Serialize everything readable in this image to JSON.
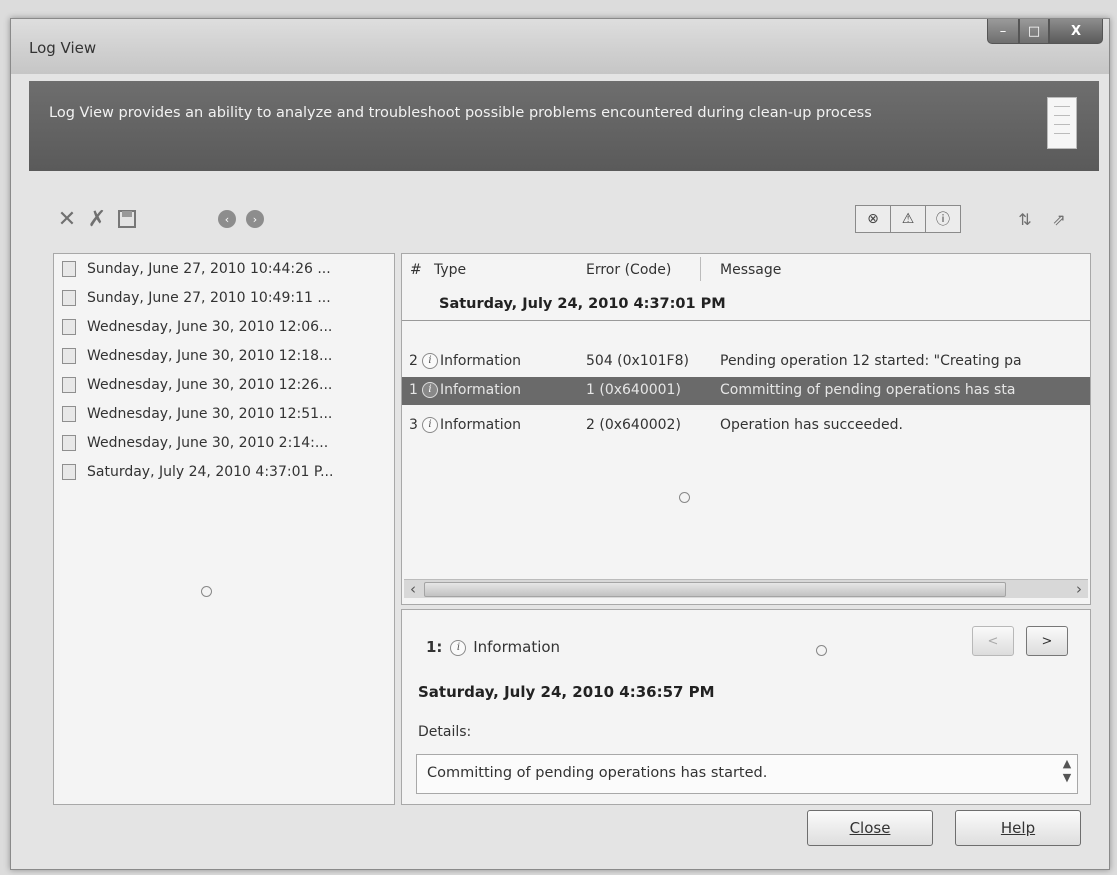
{
  "window": {
    "title": "Log View",
    "controls": {
      "minimize": "–",
      "maximize": "□",
      "close": "X"
    }
  },
  "banner": {
    "text": "Log View provides an ability to analyze and troubleshoot possible problems encountered during clean-up process"
  },
  "toolbar": {
    "delete_icon": "✕",
    "delete_all_icon": "✗",
    "save_icon": "▫",
    "back_icon": "‹",
    "forward_icon": "›",
    "filter_error_icon": "⊗",
    "filter_warning_icon": "⚠",
    "filter_info_icon": "ⓘ",
    "sort_icon": "⇅",
    "export_icon": "⇗"
  },
  "sessions": [
    "Sunday, June 27, 2010 10:44:26 ...",
    "Sunday, June 27, 2010 10:49:11 ...",
    "Wednesday, June 30, 2010 12:06...",
    "Wednesday, June 30, 2010 12:18...",
    "Wednesday, June 30, 2010 12:26...",
    "Wednesday, June 30, 2010 12:51...",
    "Wednesday, June 30, 2010 2:14:...",
    "Saturday, July 24, 2010 4:37:01 P..."
  ],
  "grid": {
    "columns": {
      "num": "#",
      "type": "Type",
      "code": "Error (Code)",
      "message": "Message"
    },
    "group": "Saturday, July 24, 2010 4:37:01 PM",
    "rows": [
      {
        "num": "2",
        "type": "Information",
        "code": "504 (0x101F8)",
        "message": "Pending operation 12 started: \"Creating pa",
        "selected": false
      },
      {
        "num": "1",
        "type": "Information",
        "code": "1 (0x640001)",
        "message": "Committing of pending operations has sta",
        "selected": true
      },
      {
        "num": "3",
        "type": "Information",
        "code": "2 (0x640002)",
        "message": "Operation has succeeded.",
        "selected": false
      }
    ],
    "info_glyph": "i",
    "scroll_left": "‹",
    "scroll_right": "›"
  },
  "detail": {
    "num": "1:",
    "type": "Information",
    "prev": "<",
    "next": ">",
    "time": "Saturday, July 24, 2010 4:36:57 PM",
    "details_label": "Details:",
    "details_text": "Committing of pending operations has started.",
    "scroll_up": "▲",
    "scroll_down": "▼"
  },
  "buttons": {
    "close": "Close",
    "help": "Help"
  }
}
